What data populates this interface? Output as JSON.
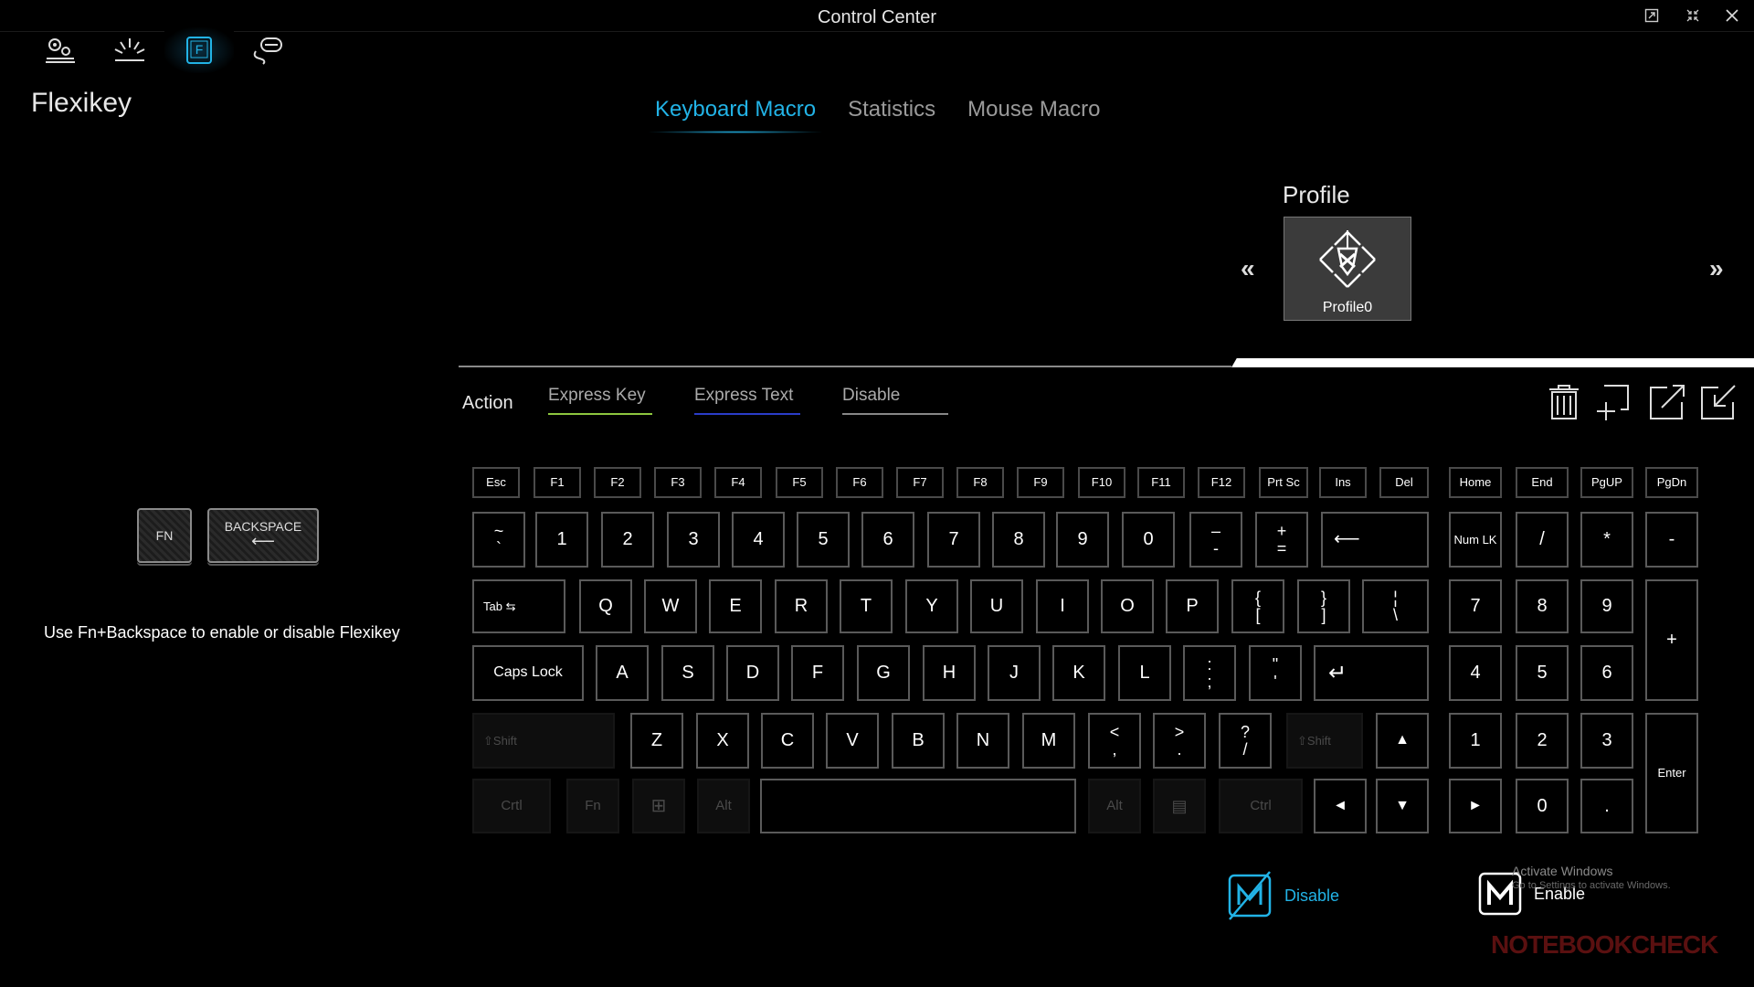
{
  "window": {
    "title": "Control Center",
    "restore_icon": "restore-icon",
    "shrink_icon": "shrink-icon",
    "close_icon": "close-icon"
  },
  "nav_icons": [
    "settings-icon",
    "lighting-icon",
    "flexikey-icon",
    "mouse-icon"
  ],
  "page_title": "Flexikey",
  "tabs": [
    {
      "label": "Keyboard Macro",
      "active": true
    },
    {
      "label": "Statistics",
      "active": false
    },
    {
      "label": "Mouse Macro",
      "active": false
    }
  ],
  "profile": {
    "label": "Profile",
    "name": "Profile0",
    "prev": "«",
    "next": "»"
  },
  "action": {
    "label": "Action",
    "tabs": [
      {
        "label": "Express Key",
        "underline": "#8dc63f"
      },
      {
        "label": "Express Text",
        "underline": "#2a3cc8"
      },
      {
        "label": "Disable",
        "underline": "#888888"
      }
    ]
  },
  "tools": [
    "trash-icon",
    "add-icon",
    "export-icon",
    "import-icon"
  ],
  "hint_keys": {
    "fn": "FN",
    "backspace": "BACKSPACE",
    "arrow": "⟵"
  },
  "hint": "Use Fn+Backspace to enable or disable Flexikey",
  "keys": {
    "esc": "Esc",
    "f1": "F1",
    "f2": "F2",
    "f3": "F3",
    "f4": "F4",
    "f5": "F5",
    "f6": "F6",
    "f7": "F7",
    "f8": "F8",
    "f9": "F9",
    "f10": "F10",
    "f11": "F11",
    "f12": "F12",
    "prtsc": "Prt Sc",
    "ins": "Ins",
    "del": "Del",
    "home": "Home",
    "end": "End",
    "pgup": "PgUP",
    "pgdn": "PgDn",
    "tilde_top": "~",
    "tilde_bot": "`",
    "n1": "1",
    "n2": "2",
    "n3": "3",
    "n4": "4",
    "n5": "5",
    "n6": "6",
    "n7": "7",
    "n8": "8",
    "n9": "9",
    "n0": "0",
    "minus_top": "–",
    "minus_bot": "-",
    "plus_top": "+",
    "plus_bot": "=",
    "backspace": "⟵",
    "numlk": "Num LK",
    "np_slash": "/",
    "np_star": "*",
    "np_minus": "-",
    "tab": "Tab ⇆",
    "q": "Q",
    "w": "W",
    "e": "E",
    "r": "R",
    "t": "T",
    "y": "Y",
    "u": "U",
    "i": "I",
    "o": "O",
    "p": "P",
    "lbrace_top": "{",
    "lbrace_bot": "[",
    "rbrace_top": "}",
    "rbrace_bot": "]",
    "pipe_top": "¦",
    "pipe_bot": "\\",
    "np7": "7",
    "np8": "8",
    "np9": "9",
    "np_plus": "+",
    "caps": "Caps Lock",
    "a": "A",
    "s": "S",
    "d": "D",
    "f": "F",
    "g": "G",
    "h": "H",
    "j": "J",
    "k": "K",
    "l": "L",
    "colon_top": ":",
    "colon_bot": ";",
    "quote_top": "\"",
    "quote_bot": "'",
    "enter": "↵",
    "np4": "4",
    "np5": "5",
    "np6": "6",
    "lshift": "⇧Shift",
    "z": "Z",
    "x": "X",
    "c": "C",
    "v": "V",
    "b": "B",
    "n": "N",
    "m": "M",
    "lt_top": "<",
    "lt_bot": ",",
    "gt_top": ">",
    "gt_bot": ".",
    "q_top": "?",
    "q_bot": "/",
    "rshift": "⇧Shift",
    "up": "▲",
    "np1": "1",
    "np2": "2",
    "np3": "3",
    "np_enter": "Enter",
    "lctrl": "Crtl",
    "fn": "Fn",
    "win": "⊞",
    "lalt": "Alt",
    "ralt": "Alt",
    "menu": "▤",
    "rctrl": "Ctrl",
    "left": "◄",
    "down": "▼",
    "right": "►",
    "np0": "0",
    "np_dot": "."
  },
  "macro_buttons": [
    {
      "label": "Disable",
      "color": "#22b3e6"
    },
    {
      "label": "Enable",
      "color": "#ffffff"
    }
  ],
  "watermark": {
    "line1": "Activate Windows",
    "line2": "Go to Settings to activate Windows."
  },
  "logo": "NOTEBOOKCHECK"
}
